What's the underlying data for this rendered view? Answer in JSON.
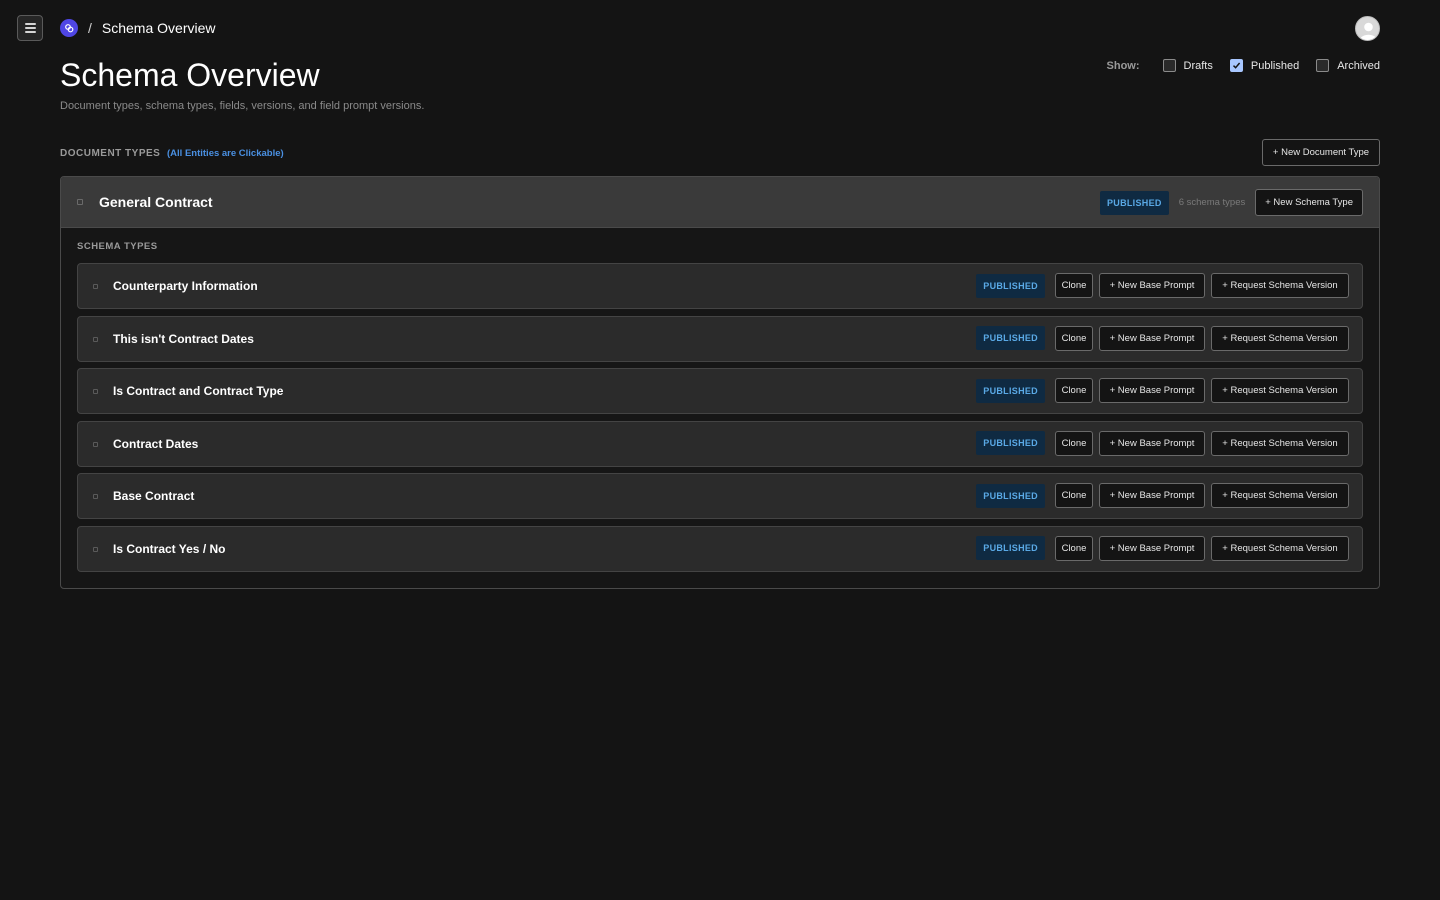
{
  "breadcrumb": {
    "separator": "/",
    "current": "Schema Overview"
  },
  "header": {
    "title": "Schema Overview",
    "subtitle": "Document types, schema types, fields, versions, and field prompt versions."
  },
  "filters": {
    "label": "Show:",
    "options": [
      {
        "label": "Drafts",
        "checked": false
      },
      {
        "label": "Published",
        "checked": true
      },
      {
        "label": "Archived",
        "checked": false
      }
    ]
  },
  "section": {
    "title": "DOCUMENT TYPES",
    "hint": "(All Entities are Clickable)",
    "new_doc_label": "+ New Document Type"
  },
  "document": {
    "name": "General Contract",
    "status": "PUBLISHED",
    "count": "6 schema types",
    "new_schema_label": "+ New Schema Type",
    "schema_label": "SCHEMA TYPES",
    "schemas": [
      {
        "name": "Counterparty Information",
        "status": "PUBLISHED",
        "clone": "Clone",
        "new_base": "+ New Base Prompt",
        "request": "+ Request Schema Version"
      },
      {
        "name": "This isn't Contract Dates",
        "status": "PUBLISHED",
        "clone": "Clone",
        "new_base": "+ New Base Prompt",
        "request": "+ Request Schema Version"
      },
      {
        "name": "Is Contract and Contract Type",
        "status": "PUBLISHED",
        "clone": "Clone",
        "new_base": "+ New Base Prompt",
        "request": "+ Request Schema Version"
      },
      {
        "name": "Contract Dates",
        "status": "PUBLISHED",
        "clone": "Clone",
        "new_base": "+ New Base Prompt",
        "request": "+ Request Schema Version"
      },
      {
        "name": "Base Contract",
        "status": "PUBLISHED",
        "clone": "Clone",
        "new_base": "+ New Base Prompt",
        "request": "+ Request Schema Version"
      },
      {
        "name": "Is Contract Yes / No",
        "status": "PUBLISHED",
        "clone": "Clone",
        "new_base": "+ New Base Prompt",
        "request": "+ Request Schema Version"
      }
    ]
  },
  "icons": {
    "menu": "menu-icon",
    "logo": "app-logo-icon",
    "avatar": "user-avatar-icon",
    "expand": "expand-icon",
    "check": "checkmark-icon"
  },
  "colors": {
    "background": "#141414",
    "badge_bg": "#0f2a42",
    "badge_text": "#5aa9e6",
    "accent_link": "#4a90e2",
    "checkbox_checked": "#a8c7ff",
    "logo": "#4f46e5"
  }
}
